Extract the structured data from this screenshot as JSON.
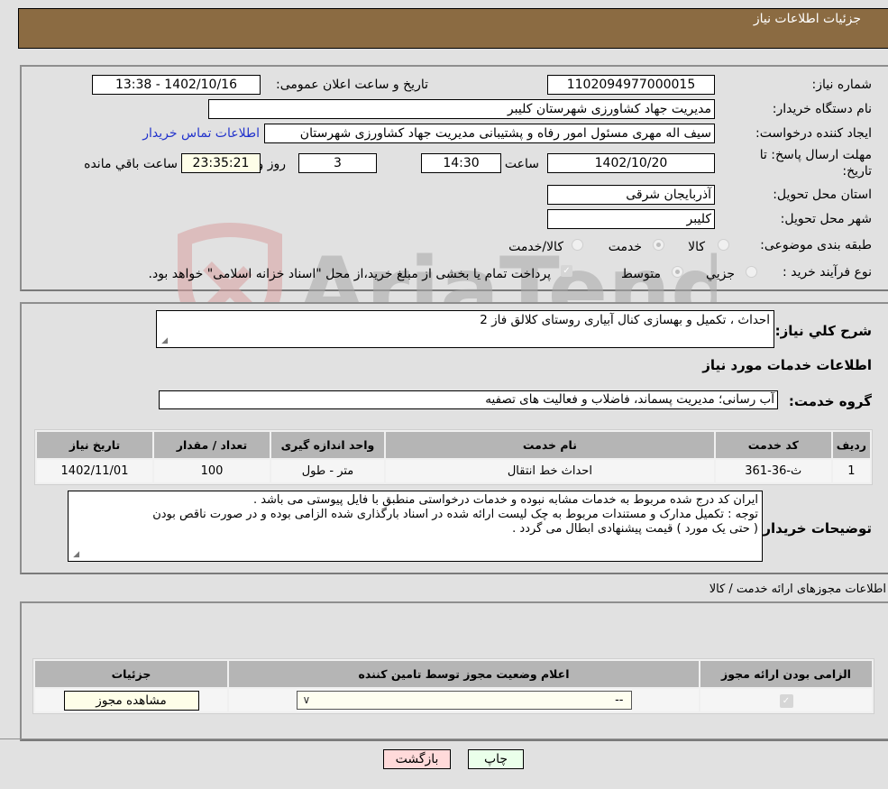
{
  "header": {
    "title": "جزئیات اطلاعات نیاز"
  },
  "details": {
    "need_number": {
      "label": "شماره نیاز:",
      "value": "1102094977000015"
    },
    "announce_datetime": {
      "label": "تاریخ و ساعت اعلان عمومی:",
      "value": "1402/10/16 - 13:38"
    },
    "buyer_org": {
      "label": "نام دستگاه خریدار:",
      "value": "مدیریت جهاد کشاورزی شهرستان کلیبر"
    },
    "requester": {
      "label": "ایجاد کننده درخواست:",
      "value": "سیف اله مهری مسئول امور رفاه و پشتیبانی مدیریت جهاد کشاورزی شهرستان",
      "contact_link": "اطلاعات تماس خریدار"
    },
    "deadline": {
      "label_line1": "مهلت ارسال پاسخ: تا",
      "label_line2": "تاریخ:",
      "date": "1402/10/20",
      "time_label": "ساعت",
      "time": "14:30",
      "days": "3",
      "days_label": "روز و",
      "remaining": "23:35:21",
      "remaining_label": "ساعت باقي مانده"
    },
    "province": {
      "label": "استان محل تحویل:",
      "value": "آذربایجان شرقی"
    },
    "city": {
      "label": "شهر محل تحویل:",
      "value": "کلیبر"
    },
    "category": {
      "label": "طبقه بندی موضوعی:",
      "options": [
        "کالا",
        "خدمت",
        "کالا/خدمت"
      ],
      "selected": "خدمت"
    },
    "purchase_type": {
      "label": "نوع فرآیند خرید :",
      "options": [
        "جزیي",
        "متوسط"
      ],
      "selected": "متوسط",
      "treasury_note": "پرداخت تمام یا بخشی از مبلغ خرید،از محل \"اسناد خزانه اسلامی\" خواهد بود.",
      "treasury_checked": true
    }
  },
  "watermark": {
    "text": "AriaTender.neT"
  },
  "services": {
    "summary_label": "شرح کلي نیاز:",
    "summary_value": "احداث ، تکمیل و بهسازی کنال آبیاری روستای کلالق فاز 2",
    "section_title": "اطلاعات خدمات مورد نیاز",
    "group_label": "گروه خدمت:",
    "group_value": "آب رسانی؛ مدیریت پسماند، فاضلاب و فعالیت های تصفیه",
    "table": {
      "headers": [
        "ردیف",
        "کد خدمت",
        "نام خدمت",
        "واحد اندازه گیری",
        "تعداد / مقدار",
        "تاریخ نیاز"
      ],
      "rows": [
        [
          "1",
          "ث-36-361",
          "احداث خط انتقال",
          "متر - طول",
          "100",
          "1402/11/01"
        ]
      ]
    },
    "buyer_notes_label": "توضیحات خریدار:",
    "buyer_notes_lines": [
      "ایران کد درج شده مربوط به خدمات مشابه نبوده و خدمات درخواستی منطبق با فایل پیوستی می باشد .",
      "توجه : تکمیل مدارک و مستندات مربوط به چک لیست ارائه شده در اسناد بارگذاری شده الزامی بوده و در صورت ناقص بودن",
      "( حتی یک مورد ) قیمت پیشنهادی ابطال می گردد ."
    ]
  },
  "permits": {
    "section_title": "اطلاعات مجوزهای ارائه خدمت / کالا",
    "table": {
      "headers": [
        "الزامی بودن ارائه مجوز",
        "اعلام وضعیت مجوز توسط تامین کننده",
        "جزئیات"
      ],
      "row": {
        "required_checked": true,
        "status_selected": "--",
        "details_button": "مشاهده مجوز"
      }
    }
  },
  "footer": {
    "print_button": "چاپ",
    "back_button": "بازگشت"
  },
  "colors": {
    "header_bg": "#8b6b42",
    "print_bg": "#eaffea",
    "back_bg": "#ffdada",
    "remaining_bg": "#fefee8",
    "link": "#2233cc"
  }
}
